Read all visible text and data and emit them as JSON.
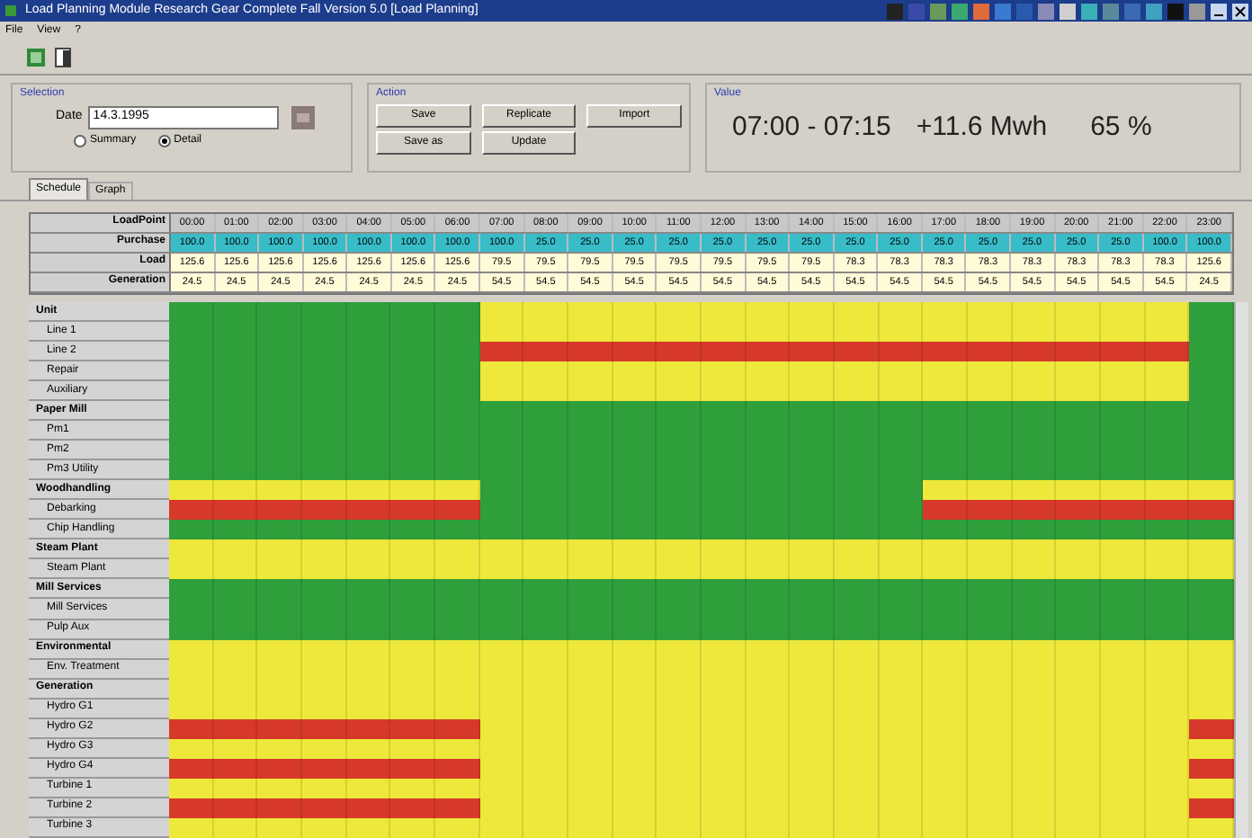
{
  "window": {
    "title": "Load Planning Module  Research Gear Complete Fall  Version 5.0  [Load Planning]"
  },
  "menu": [
    "File",
    "View",
    "?"
  ],
  "selection": {
    "title": "Selection",
    "date_label": "Date",
    "date_value": "14.3.1995",
    "options": [
      {
        "label": "Summary",
        "selected": false
      },
      {
        "label": "Detail",
        "selected": true
      }
    ]
  },
  "action": {
    "title": "Action",
    "buttons": [
      "Save",
      "Replicate",
      "Import",
      "Save as",
      "Update"
    ]
  },
  "value": {
    "title": "Value",
    "period": "07:00 - 07:15",
    "energy": "+11.6 Mwh",
    "percent": "65 %"
  },
  "tabs": [
    {
      "label": "Schedule",
      "selected": true
    },
    {
      "label": "Graph",
      "selected": false
    }
  ],
  "summary": [
    {
      "label": "LoadPoint",
      "kind": "time",
      "cells": [
        "00:00",
        "01:00",
        "02:00",
        "03:00",
        "04:00",
        "05:00",
        "06:00",
        "07:00",
        "08:00",
        "09:00",
        "10:00",
        "11:00",
        "12:00",
        "13:00",
        "14:00",
        "15:00",
        "16:00",
        "17:00",
        "18:00",
        "19:00",
        "20:00",
        "21:00",
        "22:00",
        "23:00"
      ]
    },
    {
      "label": "Purchase",
      "kind": "purchase",
      "cells": [
        "100.0",
        "100.0",
        "100.0",
        "100.0",
        "100.0",
        "100.0",
        "100.0",
        "100.0",
        "25.0",
        "25.0",
        "25.0",
        "25.0",
        "25.0",
        "25.0",
        "25.0",
        "25.0",
        "25.0",
        "25.0",
        "25.0",
        "25.0",
        "25.0",
        "25.0",
        "100.0",
        "100.0"
      ]
    },
    {
      "label": "Load",
      "kind": "value",
      "cells": [
        "125.6",
        "125.6",
        "125.6",
        "125.6",
        "125.6",
        "125.6",
        "125.6",
        "79.5",
        "79.5",
        "79.5",
        "79.5",
        "79.5",
        "79.5",
        "79.5",
        "79.5",
        "78.3",
        "78.3",
        "78.3",
        "78.3",
        "78.3",
        "78.3",
        "78.3",
        "78.3",
        "125.6"
      ]
    },
    {
      "label": "Generation",
      "kind": "value",
      "cells": [
        "24.5",
        "24.5",
        "24.5",
        "24.5",
        "24.5",
        "24.5",
        "24.5",
        "54.5",
        "54.5",
        "54.5",
        "54.5",
        "54.5",
        "54.5",
        "54.5",
        "54.5",
        "54.5",
        "54.5",
        "54.5",
        "54.5",
        "54.5",
        "54.5",
        "54.5",
        "54.5",
        "24.5"
      ]
    }
  ],
  "schedule": [
    {
      "label": "Unit",
      "kind": "group",
      "slots": [
        {
          "color": "#2f9f3c"
        },
        {
          "color": "#2f9f3c"
        },
        {
          "color": "#2f9f3c"
        },
        {
          "color": "#2f9f3c"
        },
        {
          "color": "#2f9f3c"
        },
        {
          "color": "#2f9f3c"
        },
        {
          "color": "#2f9f3c"
        },
        {
          "color": "#eee83a"
        },
        {
          "color": "#eee83a"
        },
        {
          "color": "#eee83a"
        },
        {
          "color": "#eee83a"
        },
        {
          "color": "#eee83a"
        },
        {
          "color": "#eee83a"
        },
        {
          "color": "#eee83a"
        },
        {
          "color": "#eee83a"
        },
        {
          "color": "#eee83a"
        },
        {
          "color": "#eee83a"
        },
        {
          "color": "#eee83a"
        },
        {
          "color": "#eee83a"
        },
        {
          "color": "#eee83a"
        },
        {
          "color": "#eee83a"
        },
        {
          "color": "#eee83a"
        },
        {
          "color": "#eee83a"
        },
        {
          "color": "#2f9f3c"
        }
      ]
    },
    {
      "label": "Line 1",
      "kind": "item",
      "slots": [
        {
          "color": "#2f9f3c"
        },
        {
          "color": "#2f9f3c"
        },
        {
          "color": "#2f9f3c"
        },
        {
          "color": "#2f9f3c"
        },
        {
          "color": "#2f9f3c"
        },
        {
          "color": "#2f9f3c"
        },
        {
          "color": "#2f9f3c"
        },
        {
          "color": "#eee83a"
        },
        {
          "color": "#eee83a"
        },
        {
          "color": "#eee83a"
        },
        {
          "color": "#eee83a"
        },
        {
          "color": "#eee83a"
        },
        {
          "color": "#eee83a"
        },
        {
          "color": "#eee83a"
        },
        {
          "color": "#eee83a"
        },
        {
          "color": "#eee83a"
        },
        {
          "color": "#eee83a"
        },
        {
          "color": "#eee83a"
        },
        {
          "color": "#eee83a"
        },
        {
          "color": "#eee83a"
        },
        {
          "color": "#eee83a"
        },
        {
          "color": "#eee83a"
        },
        {
          "color": "#eee83a"
        },
        {
          "color": "#2f9f3c"
        }
      ]
    },
    {
      "label": "Line 2",
      "kind": "item",
      "slots": [
        {
          "color": "#2f9f3c"
        },
        {
          "color": "#2f9f3c"
        },
        {
          "color": "#2f9f3c"
        },
        {
          "color": "#2f9f3c"
        },
        {
          "color": "#2f9f3c"
        },
        {
          "color": "#2f9f3c"
        },
        {
          "color": "#2f9f3c"
        },
        {
          "color": "#d6392a"
        },
        {
          "color": "#d6392a"
        },
        {
          "color": "#d6392a"
        },
        {
          "color": "#d6392a"
        },
        {
          "color": "#d6392a"
        },
        {
          "color": "#d6392a"
        },
        {
          "color": "#d6392a"
        },
        {
          "color": "#d6392a"
        },
        {
          "color": "#d6392a"
        },
        {
          "color": "#d6392a"
        },
        {
          "color": "#d6392a"
        },
        {
          "color": "#d6392a"
        },
        {
          "color": "#d6392a"
        },
        {
          "color": "#d6392a"
        },
        {
          "color": "#d6392a"
        },
        {
          "color": "#d6392a"
        },
        {
          "color": "#2f9f3c"
        }
      ]
    },
    {
      "label": "Repair",
      "kind": "item",
      "slots": [
        {
          "color": "#2f9f3c"
        },
        {
          "color": "#2f9f3c"
        },
        {
          "color": "#2f9f3c"
        },
        {
          "color": "#2f9f3c"
        },
        {
          "color": "#2f9f3c"
        },
        {
          "color": "#2f9f3c"
        },
        {
          "color": "#2f9f3c"
        },
        {
          "color": "#eee83a"
        },
        {
          "color": "#eee83a"
        },
        {
          "color": "#eee83a"
        },
        {
          "color": "#eee83a"
        },
        {
          "color": "#eee83a"
        },
        {
          "color": "#eee83a"
        },
        {
          "color": "#eee83a"
        },
        {
          "color": "#eee83a"
        },
        {
          "color": "#eee83a"
        },
        {
          "color": "#eee83a"
        },
        {
          "color": "#eee83a"
        },
        {
          "color": "#eee83a"
        },
        {
          "color": "#eee83a"
        },
        {
          "color": "#eee83a"
        },
        {
          "color": "#eee83a"
        },
        {
          "color": "#eee83a"
        },
        {
          "color": "#2f9f3c"
        }
      ]
    },
    {
      "label": "Auxiliary",
      "kind": "item",
      "slots": [
        {
          "color": "#2f9f3c"
        },
        {
          "color": "#2f9f3c"
        },
        {
          "color": "#2f9f3c"
        },
        {
          "color": "#2f9f3c"
        },
        {
          "color": "#2f9f3c"
        },
        {
          "color": "#2f9f3c"
        },
        {
          "color": "#2f9f3c"
        },
        {
          "color": "#eee83a"
        },
        {
          "color": "#eee83a"
        },
        {
          "color": "#eee83a"
        },
        {
          "color": "#eee83a"
        },
        {
          "color": "#eee83a"
        },
        {
          "color": "#eee83a"
        },
        {
          "color": "#eee83a"
        },
        {
          "color": "#eee83a"
        },
        {
          "color": "#eee83a"
        },
        {
          "color": "#eee83a"
        },
        {
          "color": "#eee83a"
        },
        {
          "color": "#eee83a"
        },
        {
          "color": "#eee83a"
        },
        {
          "color": "#eee83a"
        },
        {
          "color": "#eee83a"
        },
        {
          "color": "#eee83a"
        },
        {
          "color": "#2f9f3c"
        }
      ]
    },
    {
      "label": "Paper Mill",
      "kind": "group",
      "slots": [
        {
          "color": "#2f9f3c"
        },
        {
          "color": "#2f9f3c"
        },
        {
          "color": "#2f9f3c"
        },
        {
          "color": "#2f9f3c"
        },
        {
          "color": "#2f9f3c"
        },
        {
          "color": "#2f9f3c"
        },
        {
          "color": "#2f9f3c"
        },
        {
          "color": "#2f9f3c"
        },
        {
          "color": "#2f9f3c"
        },
        {
          "color": "#2f9f3c"
        },
        {
          "color": "#2f9f3c"
        },
        {
          "color": "#2f9f3c"
        },
        {
          "color": "#2f9f3c"
        },
        {
          "color": "#2f9f3c"
        },
        {
          "color": "#2f9f3c"
        },
        {
          "color": "#2f9f3c"
        },
        {
          "color": "#2f9f3c"
        },
        {
          "color": "#2f9f3c"
        },
        {
          "color": "#2f9f3c"
        },
        {
          "color": "#2f9f3c"
        },
        {
          "color": "#2f9f3c"
        },
        {
          "color": "#2f9f3c"
        },
        {
          "color": "#2f9f3c"
        },
        {
          "color": "#2f9f3c"
        }
      ]
    },
    {
      "label": "Pm1",
      "kind": "item",
      "slots": [
        {
          "color": "#2f9f3c"
        },
        {
          "color": "#2f9f3c"
        },
        {
          "color": "#2f9f3c"
        },
        {
          "color": "#2f9f3c"
        },
        {
          "color": "#2f9f3c"
        },
        {
          "color": "#2f9f3c"
        },
        {
          "color": "#2f9f3c"
        },
        {
          "color": "#2f9f3c"
        },
        {
          "color": "#2f9f3c"
        },
        {
          "color": "#2f9f3c"
        },
        {
          "color": "#2f9f3c"
        },
        {
          "color": "#2f9f3c"
        },
        {
          "color": "#2f9f3c"
        },
        {
          "color": "#2f9f3c"
        },
        {
          "color": "#2f9f3c"
        },
        {
          "color": "#2f9f3c"
        },
        {
          "color": "#2f9f3c"
        },
        {
          "color": "#2f9f3c"
        },
        {
          "color": "#2f9f3c"
        },
        {
          "color": "#2f9f3c"
        },
        {
          "color": "#2f9f3c"
        },
        {
          "color": "#2f9f3c"
        },
        {
          "color": "#2f9f3c"
        },
        {
          "color": "#2f9f3c"
        }
      ]
    },
    {
      "label": "Pm2",
      "kind": "item",
      "slots": [
        {
          "color": "#2f9f3c"
        },
        {
          "color": "#2f9f3c"
        },
        {
          "color": "#2f9f3c"
        },
        {
          "color": "#2f9f3c"
        },
        {
          "color": "#2f9f3c"
        },
        {
          "color": "#2f9f3c"
        },
        {
          "color": "#2f9f3c"
        },
        {
          "color": "#2f9f3c"
        },
        {
          "color": "#2f9f3c"
        },
        {
          "color": "#2f9f3c"
        },
        {
          "color": "#2f9f3c"
        },
        {
          "color": "#2f9f3c"
        },
        {
          "color": "#2f9f3c"
        },
        {
          "color": "#2f9f3c"
        },
        {
          "color": "#2f9f3c"
        },
        {
          "color": "#2f9f3c"
        },
        {
          "color": "#2f9f3c"
        },
        {
          "color": "#2f9f3c"
        },
        {
          "color": "#2f9f3c"
        },
        {
          "color": "#2f9f3c"
        },
        {
          "color": "#2f9f3c"
        },
        {
          "color": "#2f9f3c"
        },
        {
          "color": "#2f9f3c"
        },
        {
          "color": "#2f9f3c"
        }
      ]
    },
    {
      "label": "Pm3 Utility",
      "kind": "item",
      "slots": [
        {
          "color": "#2f9f3c"
        },
        {
          "color": "#2f9f3c"
        },
        {
          "color": "#2f9f3c"
        },
        {
          "color": "#2f9f3c"
        },
        {
          "color": "#2f9f3c"
        },
        {
          "color": "#2f9f3c"
        },
        {
          "color": "#2f9f3c"
        },
        {
          "color": "#2f9f3c"
        },
        {
          "color": "#2f9f3c"
        },
        {
          "color": "#2f9f3c"
        },
        {
          "color": "#2f9f3c"
        },
        {
          "color": "#2f9f3c"
        },
        {
          "color": "#2f9f3c"
        },
        {
          "color": "#2f9f3c"
        },
        {
          "color": "#2f9f3c"
        },
        {
          "color": "#2f9f3c"
        },
        {
          "color": "#2f9f3c"
        },
        {
          "color": "#2f9f3c"
        },
        {
          "color": "#2f9f3c"
        },
        {
          "color": "#2f9f3c"
        },
        {
          "color": "#2f9f3c"
        },
        {
          "color": "#2f9f3c"
        },
        {
          "color": "#2f9f3c"
        },
        {
          "color": "#2f9f3c"
        }
      ]
    },
    {
      "label": "Woodhandling",
      "kind": "group",
      "slots": [
        {
          "color": "#eee83a"
        },
        {
          "color": "#eee83a"
        },
        {
          "color": "#eee83a"
        },
        {
          "color": "#eee83a"
        },
        {
          "color": "#eee83a"
        },
        {
          "color": "#eee83a"
        },
        {
          "color": "#eee83a"
        },
        {
          "color": "#2f9f3c"
        },
        {
          "color": "#2f9f3c"
        },
        {
          "color": "#2f9f3c"
        },
        {
          "color": "#2f9f3c"
        },
        {
          "color": "#2f9f3c"
        },
        {
          "color": "#2f9f3c"
        },
        {
          "color": "#2f9f3c"
        },
        {
          "color": "#2f9f3c"
        },
        {
          "color": "#2f9f3c"
        },
        {
          "color": "#2f9f3c"
        },
        {
          "color": "#eee83a"
        },
        {
          "color": "#eee83a"
        },
        {
          "color": "#eee83a"
        },
        {
          "color": "#eee83a"
        },
        {
          "color": "#eee83a"
        },
        {
          "color": "#eee83a"
        },
        {
          "color": "#eee83a"
        }
      ]
    },
    {
      "label": "Debarking",
      "kind": "item",
      "slots": [
        {
          "color": "#d6392a"
        },
        {
          "color": "#d6392a"
        },
        {
          "color": "#d6392a"
        },
        {
          "color": "#d6392a"
        },
        {
          "color": "#d6392a"
        },
        {
          "color": "#d6392a"
        },
        {
          "color": "#d6392a"
        },
        {
          "color": "#2f9f3c"
        },
        {
          "color": "#2f9f3c"
        },
        {
          "color": "#2f9f3c"
        },
        {
          "color": "#2f9f3c"
        },
        {
          "color": "#2f9f3c"
        },
        {
          "color": "#2f9f3c"
        },
        {
          "color": "#2f9f3c"
        },
        {
          "color": "#2f9f3c"
        },
        {
          "color": "#2f9f3c"
        },
        {
          "color": "#2f9f3c"
        },
        {
          "color": "#d6392a"
        },
        {
          "color": "#d6392a"
        },
        {
          "color": "#d6392a"
        },
        {
          "color": "#d6392a"
        },
        {
          "color": "#d6392a"
        },
        {
          "color": "#d6392a"
        },
        {
          "color": "#d6392a"
        }
      ]
    },
    {
      "label": "Chip Handling",
      "kind": "item",
      "slots": [
        {
          "color": "#2f9f3c"
        },
        {
          "color": "#2f9f3c"
        },
        {
          "color": "#2f9f3c"
        },
        {
          "color": "#2f9f3c"
        },
        {
          "color": "#2f9f3c"
        },
        {
          "color": "#2f9f3c"
        },
        {
          "color": "#2f9f3c"
        },
        {
          "color": "#2f9f3c"
        },
        {
          "color": "#2f9f3c"
        },
        {
          "color": "#2f9f3c"
        },
        {
          "color": "#2f9f3c"
        },
        {
          "color": "#2f9f3c"
        },
        {
          "color": "#2f9f3c"
        },
        {
          "color": "#2f9f3c"
        },
        {
          "color": "#2f9f3c"
        },
        {
          "color": "#2f9f3c"
        },
        {
          "color": "#2f9f3c"
        },
        {
          "color": "#2f9f3c"
        },
        {
          "color": "#2f9f3c"
        },
        {
          "color": "#2f9f3c"
        },
        {
          "color": "#2f9f3c"
        },
        {
          "color": "#2f9f3c"
        },
        {
          "color": "#2f9f3c"
        },
        {
          "color": "#2f9f3c"
        }
      ]
    },
    {
      "label": "Steam Plant",
      "kind": "group",
      "slots": [
        {
          "color": "#eee83a"
        },
        {
          "color": "#eee83a"
        },
        {
          "color": "#eee83a"
        },
        {
          "color": "#eee83a"
        },
        {
          "color": "#eee83a"
        },
        {
          "color": "#eee83a"
        },
        {
          "color": "#eee83a"
        },
        {
          "color": "#eee83a"
        },
        {
          "color": "#eee83a"
        },
        {
          "color": "#eee83a"
        },
        {
          "color": "#eee83a"
        },
        {
          "color": "#eee83a"
        },
        {
          "color": "#eee83a"
        },
        {
          "color": "#eee83a"
        },
        {
          "color": "#eee83a"
        },
        {
          "color": "#eee83a"
        },
        {
          "color": "#eee83a"
        },
        {
          "color": "#eee83a"
        },
        {
          "color": "#eee83a"
        },
        {
          "color": "#eee83a"
        },
        {
          "color": "#eee83a"
        },
        {
          "color": "#eee83a"
        },
        {
          "color": "#eee83a"
        },
        {
          "color": "#eee83a"
        }
      ]
    },
    {
      "label": "Steam Plant",
      "kind": "item",
      "slots": [
        {
          "color": "#eee83a"
        },
        {
          "color": "#eee83a"
        },
        {
          "color": "#eee83a"
        },
        {
          "color": "#eee83a"
        },
        {
          "color": "#eee83a"
        },
        {
          "color": "#eee83a"
        },
        {
          "color": "#eee83a"
        },
        {
          "color": "#eee83a"
        },
        {
          "color": "#eee83a"
        },
        {
          "color": "#eee83a"
        },
        {
          "color": "#eee83a"
        },
        {
          "color": "#eee83a"
        },
        {
          "color": "#eee83a"
        },
        {
          "color": "#eee83a"
        },
        {
          "color": "#eee83a"
        },
        {
          "color": "#eee83a"
        },
        {
          "color": "#eee83a"
        },
        {
          "color": "#eee83a"
        },
        {
          "color": "#eee83a"
        },
        {
          "color": "#eee83a"
        },
        {
          "color": "#eee83a"
        },
        {
          "color": "#eee83a"
        },
        {
          "color": "#eee83a"
        },
        {
          "color": "#eee83a"
        }
      ]
    },
    {
      "label": "Mill Services",
      "kind": "group",
      "slots": [
        {
          "color": "#2f9f3c"
        },
        {
          "color": "#2f9f3c"
        },
        {
          "color": "#2f9f3c"
        },
        {
          "color": "#2f9f3c"
        },
        {
          "color": "#2f9f3c"
        },
        {
          "color": "#2f9f3c"
        },
        {
          "color": "#2f9f3c"
        },
        {
          "color": "#2f9f3c"
        },
        {
          "color": "#2f9f3c"
        },
        {
          "color": "#2f9f3c"
        },
        {
          "color": "#2f9f3c"
        },
        {
          "color": "#2f9f3c"
        },
        {
          "color": "#2f9f3c"
        },
        {
          "color": "#2f9f3c"
        },
        {
          "color": "#2f9f3c"
        },
        {
          "color": "#2f9f3c"
        },
        {
          "color": "#2f9f3c"
        },
        {
          "color": "#2f9f3c"
        },
        {
          "color": "#2f9f3c"
        },
        {
          "color": "#2f9f3c"
        },
        {
          "color": "#2f9f3c"
        },
        {
          "color": "#2f9f3c"
        },
        {
          "color": "#2f9f3c"
        },
        {
          "color": "#2f9f3c"
        }
      ]
    },
    {
      "label": "Mill Services",
      "kind": "item",
      "slots": [
        {
          "color": "#2f9f3c"
        },
        {
          "color": "#2f9f3c"
        },
        {
          "color": "#2f9f3c"
        },
        {
          "color": "#2f9f3c"
        },
        {
          "color": "#2f9f3c"
        },
        {
          "color": "#2f9f3c"
        },
        {
          "color": "#2f9f3c"
        },
        {
          "color": "#2f9f3c"
        },
        {
          "color": "#2f9f3c"
        },
        {
          "color": "#2f9f3c"
        },
        {
          "color": "#2f9f3c"
        },
        {
          "color": "#2f9f3c"
        },
        {
          "color": "#2f9f3c"
        },
        {
          "color": "#2f9f3c"
        },
        {
          "color": "#2f9f3c"
        },
        {
          "color": "#2f9f3c"
        },
        {
          "color": "#2f9f3c"
        },
        {
          "color": "#2f9f3c"
        },
        {
          "color": "#2f9f3c"
        },
        {
          "color": "#2f9f3c"
        },
        {
          "color": "#2f9f3c"
        },
        {
          "color": "#2f9f3c"
        },
        {
          "color": "#2f9f3c"
        },
        {
          "color": "#2f9f3c"
        }
      ]
    },
    {
      "label": "Pulp Aux",
      "kind": "item",
      "slots": [
        {
          "color": "#2f9f3c"
        },
        {
          "color": "#2f9f3c"
        },
        {
          "color": "#2f9f3c"
        },
        {
          "color": "#2f9f3c"
        },
        {
          "color": "#2f9f3c"
        },
        {
          "color": "#2f9f3c"
        },
        {
          "color": "#2f9f3c"
        },
        {
          "color": "#2f9f3c"
        },
        {
          "color": "#2f9f3c"
        },
        {
          "color": "#2f9f3c"
        },
        {
          "color": "#2f9f3c"
        },
        {
          "color": "#2f9f3c"
        },
        {
          "color": "#2f9f3c"
        },
        {
          "color": "#2f9f3c"
        },
        {
          "color": "#2f9f3c"
        },
        {
          "color": "#2f9f3c"
        },
        {
          "color": "#2f9f3c"
        },
        {
          "color": "#2f9f3c"
        },
        {
          "color": "#2f9f3c"
        },
        {
          "color": "#2f9f3c"
        },
        {
          "color": "#2f9f3c"
        },
        {
          "color": "#2f9f3c"
        },
        {
          "color": "#2f9f3c"
        },
        {
          "color": "#2f9f3c"
        }
      ]
    },
    {
      "label": "Environmental",
      "kind": "group",
      "slots": [
        {
          "color": "#eee83a"
        },
        {
          "color": "#eee83a"
        },
        {
          "color": "#eee83a"
        },
        {
          "color": "#eee83a"
        },
        {
          "color": "#eee83a"
        },
        {
          "color": "#eee83a"
        },
        {
          "color": "#eee83a"
        },
        {
          "color": "#eee83a"
        },
        {
          "color": "#eee83a"
        },
        {
          "color": "#eee83a"
        },
        {
          "color": "#eee83a"
        },
        {
          "color": "#eee83a"
        },
        {
          "color": "#eee83a"
        },
        {
          "color": "#eee83a"
        },
        {
          "color": "#eee83a"
        },
        {
          "color": "#eee83a"
        },
        {
          "color": "#eee83a"
        },
        {
          "color": "#eee83a"
        },
        {
          "color": "#eee83a"
        },
        {
          "color": "#eee83a"
        },
        {
          "color": "#eee83a"
        },
        {
          "color": "#eee83a"
        },
        {
          "color": "#eee83a"
        },
        {
          "color": "#eee83a"
        }
      ]
    },
    {
      "label": "Env. Treatment",
      "kind": "item",
      "slots": [
        {
          "color": "#eee83a"
        },
        {
          "color": "#eee83a"
        },
        {
          "color": "#eee83a"
        },
        {
          "color": "#eee83a"
        },
        {
          "color": "#eee83a"
        },
        {
          "color": "#eee83a"
        },
        {
          "color": "#eee83a"
        },
        {
          "color": "#eee83a"
        },
        {
          "color": "#eee83a"
        },
        {
          "color": "#eee83a"
        },
        {
          "color": "#eee83a"
        },
        {
          "color": "#eee83a"
        },
        {
          "color": "#eee83a"
        },
        {
          "color": "#eee83a"
        },
        {
          "color": "#eee83a"
        },
        {
          "color": "#eee83a"
        },
        {
          "color": "#eee83a"
        },
        {
          "color": "#eee83a"
        },
        {
          "color": "#eee83a"
        },
        {
          "color": "#eee83a"
        },
        {
          "color": "#eee83a"
        },
        {
          "color": "#eee83a"
        },
        {
          "color": "#eee83a"
        },
        {
          "color": "#eee83a"
        }
      ]
    },
    {
      "label": "Generation",
      "kind": "group",
      "slots": [
        {
          "color": "#eee83a"
        },
        {
          "color": "#eee83a"
        },
        {
          "color": "#eee83a"
        },
        {
          "color": "#eee83a"
        },
        {
          "color": "#eee83a"
        },
        {
          "color": "#eee83a"
        },
        {
          "color": "#eee83a"
        },
        {
          "color": "#eee83a"
        },
        {
          "color": "#eee83a"
        },
        {
          "color": "#eee83a"
        },
        {
          "color": "#eee83a"
        },
        {
          "color": "#eee83a"
        },
        {
          "color": "#eee83a"
        },
        {
          "color": "#eee83a"
        },
        {
          "color": "#eee83a"
        },
        {
          "color": "#eee83a"
        },
        {
          "color": "#eee83a"
        },
        {
          "color": "#eee83a"
        },
        {
          "color": "#eee83a"
        },
        {
          "color": "#eee83a"
        },
        {
          "color": "#eee83a"
        },
        {
          "color": "#eee83a"
        },
        {
          "color": "#eee83a"
        },
        {
          "color": "#eee83a"
        }
      ]
    },
    {
      "label": "Hydro G1",
      "kind": "item",
      "slots": [
        {
          "color": "#eee83a"
        },
        {
          "color": "#eee83a"
        },
        {
          "color": "#eee83a"
        },
        {
          "color": "#eee83a"
        },
        {
          "color": "#eee83a"
        },
        {
          "color": "#eee83a"
        },
        {
          "color": "#eee83a"
        },
        {
          "color": "#eee83a"
        },
        {
          "color": "#eee83a"
        },
        {
          "color": "#eee83a"
        },
        {
          "color": "#eee83a"
        },
        {
          "color": "#eee83a"
        },
        {
          "color": "#eee83a"
        },
        {
          "color": "#eee83a"
        },
        {
          "color": "#eee83a"
        },
        {
          "color": "#eee83a"
        },
        {
          "color": "#eee83a"
        },
        {
          "color": "#eee83a"
        },
        {
          "color": "#eee83a"
        },
        {
          "color": "#eee83a"
        },
        {
          "color": "#eee83a"
        },
        {
          "color": "#eee83a"
        },
        {
          "color": "#eee83a"
        },
        {
          "color": "#eee83a"
        }
      ]
    },
    {
      "label": "Hydro G2",
      "kind": "item",
      "slots": [
        {
          "color": "#d6392a"
        },
        {
          "color": "#d6392a"
        },
        {
          "color": "#d6392a"
        },
        {
          "color": "#d6392a"
        },
        {
          "color": "#d6392a"
        },
        {
          "color": "#d6392a"
        },
        {
          "color": "#d6392a"
        },
        {
          "color": "#eee83a"
        },
        {
          "color": "#eee83a"
        },
        {
          "color": "#eee83a"
        },
        {
          "color": "#eee83a"
        },
        {
          "color": "#eee83a"
        },
        {
          "color": "#eee83a"
        },
        {
          "color": "#eee83a"
        },
        {
          "color": "#eee83a"
        },
        {
          "color": "#eee83a"
        },
        {
          "color": "#eee83a"
        },
        {
          "color": "#eee83a"
        },
        {
          "color": "#eee83a"
        },
        {
          "color": "#eee83a"
        },
        {
          "color": "#eee83a"
        },
        {
          "color": "#eee83a"
        },
        {
          "color": "#eee83a"
        },
        {
          "color": "#d6392a"
        }
      ]
    },
    {
      "label": "Hydro G3",
      "kind": "item",
      "slots": [
        {
          "color": "#eee83a"
        },
        {
          "color": "#eee83a"
        },
        {
          "color": "#eee83a"
        },
        {
          "color": "#eee83a"
        },
        {
          "color": "#eee83a"
        },
        {
          "color": "#eee83a"
        },
        {
          "color": "#eee83a"
        },
        {
          "color": "#eee83a"
        },
        {
          "color": "#eee83a"
        },
        {
          "color": "#eee83a"
        },
        {
          "color": "#eee83a"
        },
        {
          "color": "#eee83a"
        },
        {
          "color": "#eee83a"
        },
        {
          "color": "#eee83a"
        },
        {
          "color": "#eee83a"
        },
        {
          "color": "#eee83a"
        },
        {
          "color": "#eee83a"
        },
        {
          "color": "#eee83a"
        },
        {
          "color": "#eee83a"
        },
        {
          "color": "#eee83a"
        },
        {
          "color": "#eee83a"
        },
        {
          "color": "#eee83a"
        },
        {
          "color": "#eee83a"
        },
        {
          "color": "#eee83a"
        }
      ]
    },
    {
      "label": "Hydro G4",
      "kind": "item",
      "slots": [
        {
          "color": "#d6392a"
        },
        {
          "color": "#d6392a"
        },
        {
          "color": "#d6392a"
        },
        {
          "color": "#d6392a"
        },
        {
          "color": "#d6392a"
        },
        {
          "color": "#d6392a"
        },
        {
          "color": "#d6392a"
        },
        {
          "color": "#eee83a"
        },
        {
          "color": "#eee83a"
        },
        {
          "color": "#eee83a"
        },
        {
          "color": "#eee83a"
        },
        {
          "color": "#eee83a"
        },
        {
          "color": "#eee83a"
        },
        {
          "color": "#eee83a"
        },
        {
          "color": "#eee83a"
        },
        {
          "color": "#eee83a"
        },
        {
          "color": "#eee83a"
        },
        {
          "color": "#eee83a"
        },
        {
          "color": "#eee83a"
        },
        {
          "color": "#eee83a"
        },
        {
          "color": "#eee83a"
        },
        {
          "color": "#eee83a"
        },
        {
          "color": "#eee83a"
        },
        {
          "color": "#d6392a"
        }
      ]
    },
    {
      "label": "Turbine 1",
      "kind": "item",
      "slots": [
        {
          "color": "#eee83a"
        },
        {
          "color": "#eee83a"
        },
        {
          "color": "#eee83a"
        },
        {
          "color": "#eee83a"
        },
        {
          "color": "#eee83a"
        },
        {
          "color": "#eee83a"
        },
        {
          "color": "#eee83a"
        },
        {
          "color": "#eee83a"
        },
        {
          "color": "#eee83a"
        },
        {
          "color": "#eee83a"
        },
        {
          "color": "#eee83a"
        },
        {
          "color": "#eee83a"
        },
        {
          "color": "#eee83a"
        },
        {
          "color": "#eee83a"
        },
        {
          "color": "#eee83a"
        },
        {
          "color": "#eee83a"
        },
        {
          "color": "#eee83a"
        },
        {
          "color": "#eee83a"
        },
        {
          "color": "#eee83a"
        },
        {
          "color": "#eee83a"
        },
        {
          "color": "#eee83a"
        },
        {
          "color": "#eee83a"
        },
        {
          "color": "#eee83a"
        },
        {
          "color": "#eee83a"
        }
      ]
    },
    {
      "label": "Turbine 2",
      "kind": "item",
      "slots": [
        {
          "color": "#d6392a"
        },
        {
          "color": "#d6392a"
        },
        {
          "color": "#d6392a"
        },
        {
          "color": "#d6392a"
        },
        {
          "color": "#d6392a"
        },
        {
          "color": "#d6392a"
        },
        {
          "color": "#d6392a"
        },
        {
          "color": "#eee83a"
        },
        {
          "color": "#eee83a"
        },
        {
          "color": "#eee83a"
        },
        {
          "color": "#eee83a"
        },
        {
          "color": "#eee83a"
        },
        {
          "color": "#eee83a"
        },
        {
          "color": "#eee83a"
        },
        {
          "color": "#eee83a"
        },
        {
          "color": "#eee83a"
        },
        {
          "color": "#eee83a"
        },
        {
          "color": "#eee83a"
        },
        {
          "color": "#eee83a"
        },
        {
          "color": "#eee83a"
        },
        {
          "color": "#eee83a"
        },
        {
          "color": "#eee83a"
        },
        {
          "color": "#eee83a"
        },
        {
          "color": "#d6392a"
        }
      ]
    },
    {
      "label": "Turbine 3",
      "kind": "item",
      "slots": [
        {
          "color": "#eee83a"
        },
        {
          "color": "#eee83a"
        },
        {
          "color": "#eee83a"
        },
        {
          "color": "#eee83a"
        },
        {
          "color": "#eee83a"
        },
        {
          "color": "#eee83a"
        },
        {
          "color": "#eee83a"
        },
        {
          "color": "#eee83a"
        },
        {
          "color": "#eee83a"
        },
        {
          "color": "#eee83a"
        },
        {
          "color": "#eee83a"
        },
        {
          "color": "#eee83a"
        },
        {
          "color": "#eee83a"
        },
        {
          "color": "#eee83a"
        },
        {
          "color": "#eee83a"
        },
        {
          "color": "#eee83a"
        },
        {
          "color": "#eee83a"
        },
        {
          "color": "#eee83a"
        },
        {
          "color": "#eee83a"
        },
        {
          "color": "#eee83a"
        },
        {
          "color": "#eee83a"
        },
        {
          "color": "#eee83a"
        },
        {
          "color": "#eee83a"
        },
        {
          "color": "#eee83a"
        }
      ]
    }
  ]
}
